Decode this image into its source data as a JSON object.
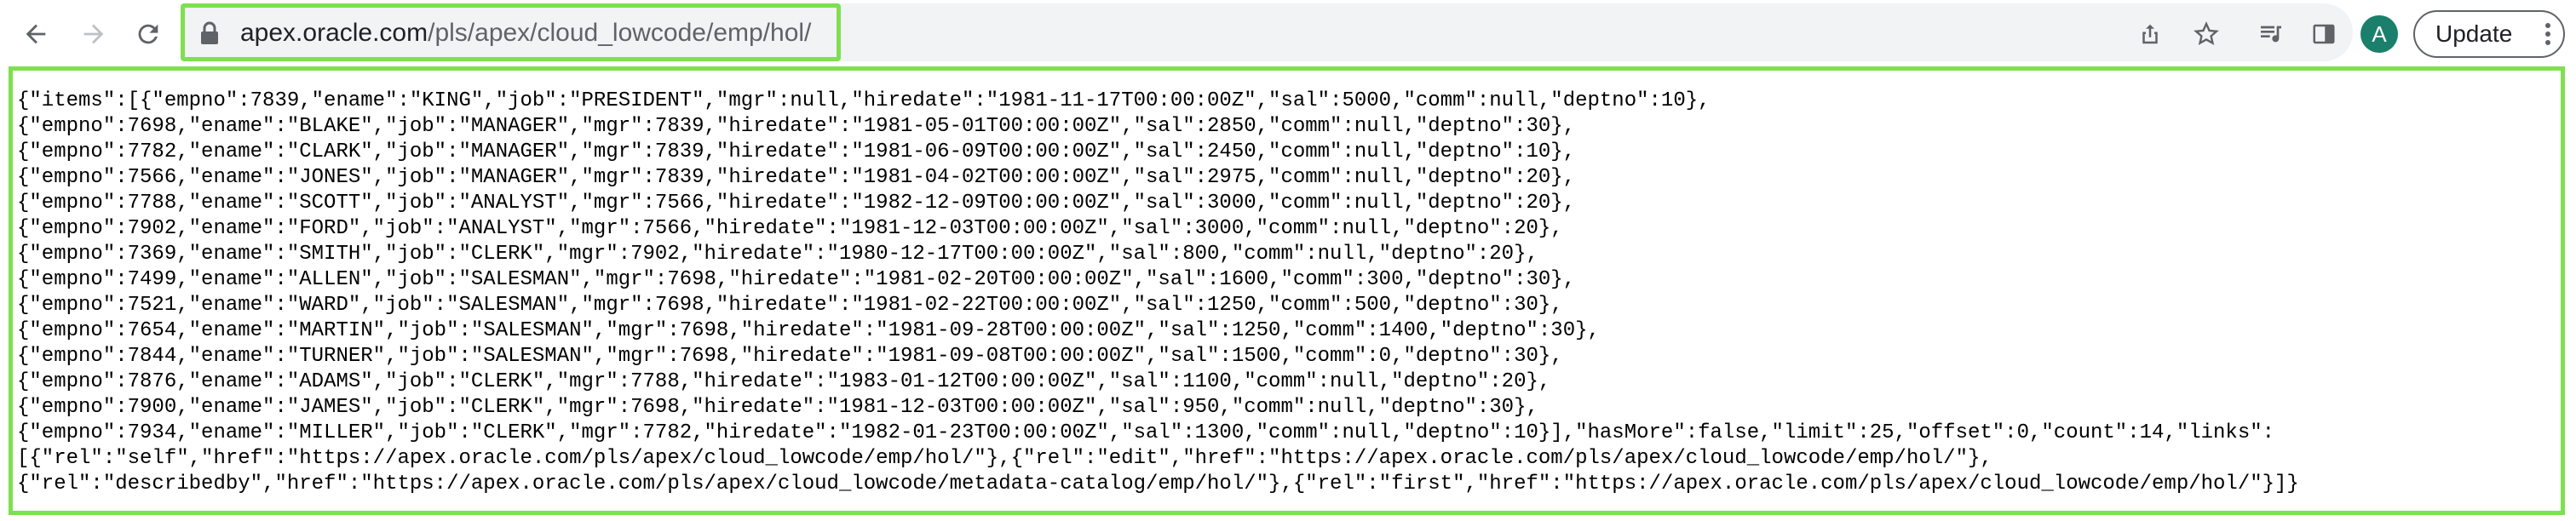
{
  "browser": {
    "url_host": "apex.oracle.com",
    "url_path": "/pls/apex/cloud_lowcode/emp/hol/",
    "avatar_letter": "A",
    "update_label": "Update"
  },
  "json_lines": [
    "{\"items\":[{\"empno\":7839,\"ename\":\"KING\",\"job\":\"PRESIDENT\",\"mgr\":null,\"hiredate\":\"1981-11-17T00:00:00Z\",\"sal\":5000,\"comm\":null,\"deptno\":10},",
    "{\"empno\":7698,\"ename\":\"BLAKE\",\"job\":\"MANAGER\",\"mgr\":7839,\"hiredate\":\"1981-05-01T00:00:00Z\",\"sal\":2850,\"comm\":null,\"deptno\":30},",
    "{\"empno\":7782,\"ename\":\"CLARK\",\"job\":\"MANAGER\",\"mgr\":7839,\"hiredate\":\"1981-06-09T00:00:00Z\",\"sal\":2450,\"comm\":null,\"deptno\":10},",
    "{\"empno\":7566,\"ename\":\"JONES\",\"job\":\"MANAGER\",\"mgr\":7839,\"hiredate\":\"1981-04-02T00:00:00Z\",\"sal\":2975,\"comm\":null,\"deptno\":20},",
    "{\"empno\":7788,\"ename\":\"SCOTT\",\"job\":\"ANALYST\",\"mgr\":7566,\"hiredate\":\"1982-12-09T00:00:00Z\",\"sal\":3000,\"comm\":null,\"deptno\":20},",
    "{\"empno\":7902,\"ename\":\"FORD\",\"job\":\"ANALYST\",\"mgr\":7566,\"hiredate\":\"1981-12-03T00:00:00Z\",\"sal\":3000,\"comm\":null,\"deptno\":20},",
    "{\"empno\":7369,\"ename\":\"SMITH\",\"job\":\"CLERK\",\"mgr\":7902,\"hiredate\":\"1980-12-17T00:00:00Z\",\"sal\":800,\"comm\":null,\"deptno\":20},",
    "{\"empno\":7499,\"ename\":\"ALLEN\",\"job\":\"SALESMAN\",\"mgr\":7698,\"hiredate\":\"1981-02-20T00:00:00Z\",\"sal\":1600,\"comm\":300,\"deptno\":30},",
    "{\"empno\":7521,\"ename\":\"WARD\",\"job\":\"SALESMAN\",\"mgr\":7698,\"hiredate\":\"1981-02-22T00:00:00Z\",\"sal\":1250,\"comm\":500,\"deptno\":30},",
    "{\"empno\":7654,\"ename\":\"MARTIN\",\"job\":\"SALESMAN\",\"mgr\":7698,\"hiredate\":\"1981-09-28T00:00:00Z\",\"sal\":1250,\"comm\":1400,\"deptno\":30},",
    "{\"empno\":7844,\"ename\":\"TURNER\",\"job\":\"SALESMAN\",\"mgr\":7698,\"hiredate\":\"1981-09-08T00:00:00Z\",\"sal\":1500,\"comm\":0,\"deptno\":30},",
    "{\"empno\":7876,\"ename\":\"ADAMS\",\"job\":\"CLERK\",\"mgr\":7788,\"hiredate\":\"1983-01-12T00:00:00Z\",\"sal\":1100,\"comm\":null,\"deptno\":20},",
    "{\"empno\":7900,\"ename\":\"JAMES\",\"job\":\"CLERK\",\"mgr\":7698,\"hiredate\":\"1981-12-03T00:00:00Z\",\"sal\":950,\"comm\":null,\"deptno\":30},",
    "{\"empno\":7934,\"ename\":\"MILLER\",\"job\":\"CLERK\",\"mgr\":7782,\"hiredate\":\"1982-01-23T00:00:00Z\",\"sal\":1300,\"comm\":null,\"deptno\":10}],\"hasMore\":false,\"limit\":25,\"offset\":0,\"count\":14,\"links\":",
    "[{\"rel\":\"self\",\"href\":\"https://apex.oracle.com/pls/apex/cloud_lowcode/emp/hol/\"},{\"rel\":\"edit\",\"href\":\"https://apex.oracle.com/pls/apex/cloud_lowcode/emp/hol/\"},",
    "{\"rel\":\"describedby\",\"href\":\"https://apex.oracle.com/pls/apex/cloud_lowcode/metadata-catalog/emp/hol/\"},{\"rel\":\"first\",\"href\":\"https://apex.oracle.com/pls/apex/cloud_lowcode/emp/hol/\"}]}"
  ],
  "colors": {
    "highlight": "#7ee04f",
    "avatar_bg": "#1a7f6b"
  }
}
